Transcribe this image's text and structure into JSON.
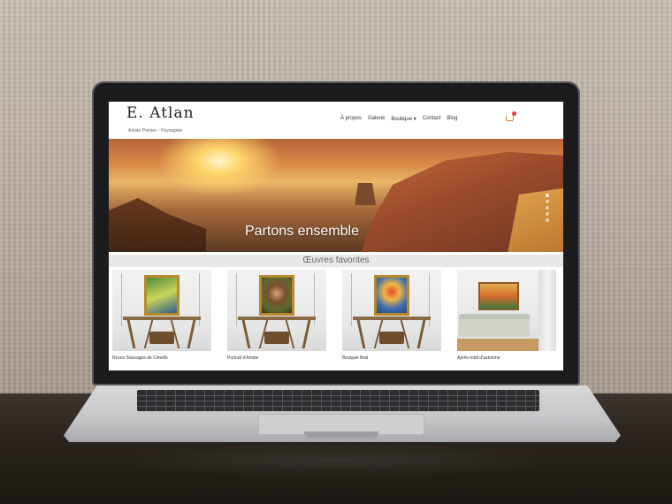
{
  "site": {
    "logo": "E. Atlan",
    "tagline": "Artiste Peintre – Paysagiste",
    "nav": [
      "À propos",
      "Galerie",
      "Boutique ▾",
      "Contact",
      "Blog"
    ],
    "cart_icon": "cart-icon"
  },
  "hero": {
    "title": "Partons ensemble",
    "slide_count": 5,
    "active_slide": 1
  },
  "favorites": {
    "title": "Œuvres favorites",
    "items": [
      {
        "caption": "Roses Sauvages de Cimello",
        "art": "painting-green-landscape"
      },
      {
        "caption": "Portrait d'Artiste",
        "art": "painting-portrait-hat"
      },
      {
        "caption": "Bouquet final",
        "art": "painting-bouquet"
      },
      {
        "caption": "Après-midi d'automne",
        "art": "painting-autumn-tree"
      }
    ]
  },
  "colors": {
    "accent": "#e87722",
    "cart_badge": "#e8413a",
    "frame_gold": "#b78a2e"
  }
}
